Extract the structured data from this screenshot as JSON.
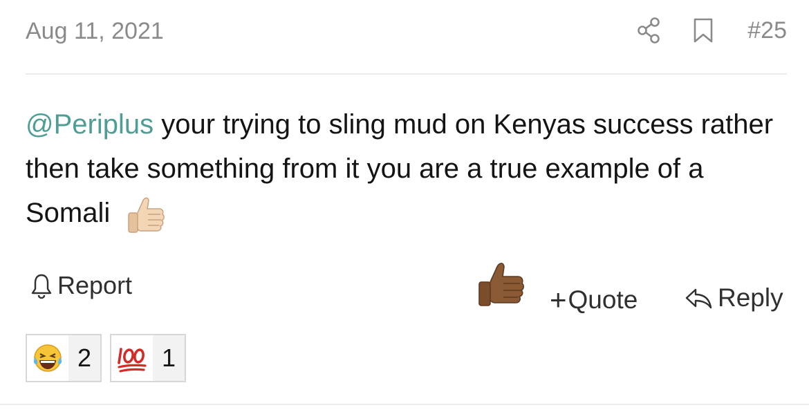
{
  "post": {
    "date": "Aug 11, 2021",
    "permalink": "#25",
    "mention": "@Periplus",
    "body_text": " your trying to sling mud on Kenyas success rather then take something from it you are a true example of a Somali",
    "actions": {
      "report_label": "Report",
      "quote_label": "Quote",
      "quote_prefix": "+",
      "reply_label": "Reply"
    },
    "reactions": [
      {
        "emoji": "laughing-tears-emoji",
        "count": "2"
      },
      {
        "emoji": "hundred-points-emoji",
        "count": "1"
      }
    ]
  },
  "colors": {
    "mention": "#4e9e96",
    "muted_text": "#8a8a8a",
    "text": "#141414"
  }
}
